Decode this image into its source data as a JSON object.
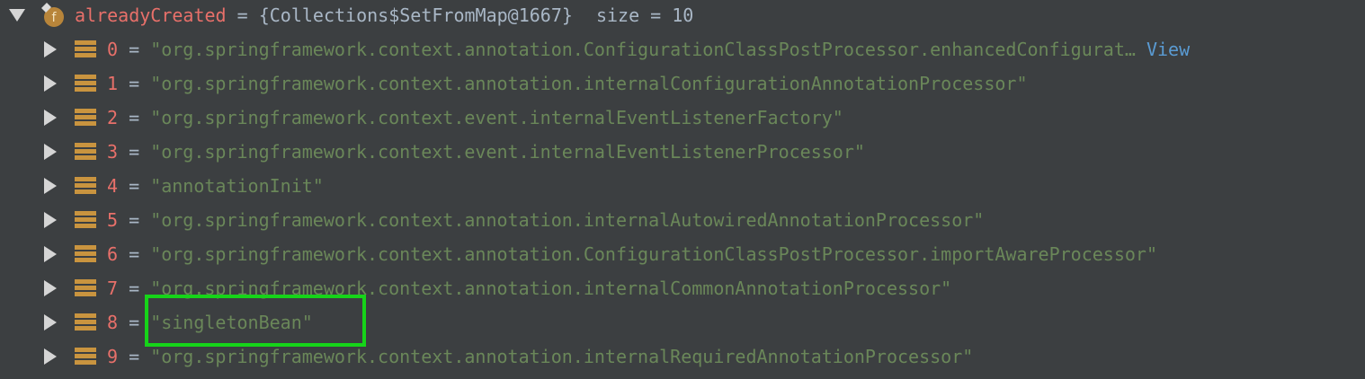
{
  "root": {
    "name": "alreadyCreated",
    "equals": "=",
    "value": "{Collections$SetFromMap@1667}",
    "size_text": "size = 10",
    "field_icon_letter": "f"
  },
  "items": [
    {
      "index": "0",
      "equals": "=",
      "value": "\"org.springframework.context.annotation.ConfigurationClassPostProcessor.enhancedConfigurat…",
      "link": "View"
    },
    {
      "index": "1",
      "equals": "=",
      "value": "\"org.springframework.context.annotation.internalConfigurationAnnotationProcessor\""
    },
    {
      "index": "2",
      "equals": "=",
      "value": "\"org.springframework.context.event.internalEventListenerFactory\""
    },
    {
      "index": "3",
      "equals": "=",
      "value": "\"org.springframework.context.event.internalEventListenerProcessor\""
    },
    {
      "index": "4",
      "equals": "=",
      "value": "\"annotationInit\""
    },
    {
      "index": "5",
      "equals": "=",
      "value": "\"org.springframework.context.annotation.internalAutowiredAnnotationProcessor\""
    },
    {
      "index": "6",
      "equals": "=",
      "value": "\"org.springframework.context.annotation.ConfigurationClassPostProcessor.importAwareProcessor\""
    },
    {
      "index": "7",
      "equals": "=",
      "value": "\"org.springframework.context.annotation.internalCommonAnnotationProcessor\""
    },
    {
      "index": "8",
      "equals": "=",
      "value": "\"singletonBean\""
    },
    {
      "index": "9",
      "equals": "=",
      "value": "\"org.springframework.context.annotation.internalRequiredAnnotationProcessor\""
    }
  ],
  "colors": {
    "background": "#3c3f41",
    "name": "#e8706a",
    "string": "#6a8759",
    "link": "#5a9bd3",
    "icon": "#c9943f",
    "highlight": "#16d419"
  },
  "icons": {
    "expand_open": "triangle-down-icon",
    "expand_closed": "triangle-right-icon",
    "field": "field-icon",
    "element": "array-element-icon"
  }
}
